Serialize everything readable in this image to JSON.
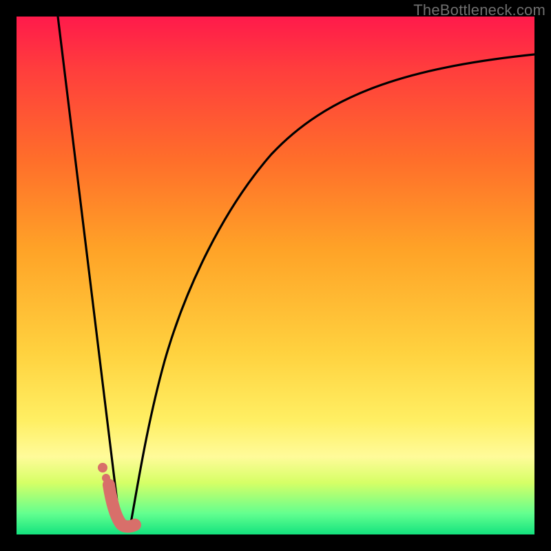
{
  "watermark": "TheBottleneck.com",
  "chart_data": {
    "type": "line",
    "title": "",
    "xlabel": "",
    "ylabel": "",
    "xlim": [
      0,
      100
    ],
    "ylim": [
      0,
      100
    ],
    "series": [
      {
        "name": "left-descent",
        "x": [
          8,
          10,
          12,
          14,
          16,
          17,
          18,
          19
        ],
        "values": [
          100,
          82,
          64,
          46,
          28,
          18,
          9,
          3
        ]
      },
      {
        "name": "right-curve",
        "x": [
          22,
          24,
          26,
          28,
          30,
          34,
          38,
          44,
          52,
          62,
          74,
          88,
          100
        ],
        "values": [
          2,
          12,
          25,
          38,
          48,
          60,
          68,
          76,
          82,
          87,
          90,
          92,
          93
        ]
      }
    ],
    "marker": {
      "name": "j-marker",
      "color": "#d86f6a",
      "points_xy": [
        [
          17.5,
          7.5
        ],
        [
          18.2,
          5.0
        ],
        [
          19.0,
          3.0
        ],
        [
          20.0,
          1.8
        ],
        [
          21.0,
          1.6
        ],
        [
          22.2,
          1.7
        ]
      ],
      "dots_xy": [
        [
          16.5,
          11.0
        ],
        [
          17.2,
          9.2
        ]
      ]
    },
    "gradient_stops": [
      {
        "pos": 0.0,
        "color": "#ff1a4b"
      },
      {
        "pos": 0.1,
        "color": "#ff3d3d"
      },
      {
        "pos": 0.28,
        "color": "#ff6f2a"
      },
      {
        "pos": 0.45,
        "color": "#ffa327"
      },
      {
        "pos": 0.65,
        "color": "#ffd23f"
      },
      {
        "pos": 0.78,
        "color": "#ffef63"
      },
      {
        "pos": 0.85,
        "color": "#fffb9a"
      },
      {
        "pos": 0.9,
        "color": "#d6ff66"
      },
      {
        "pos": 0.96,
        "color": "#62ff8f"
      },
      {
        "pos": 1.0,
        "color": "#13e27e"
      }
    ]
  }
}
